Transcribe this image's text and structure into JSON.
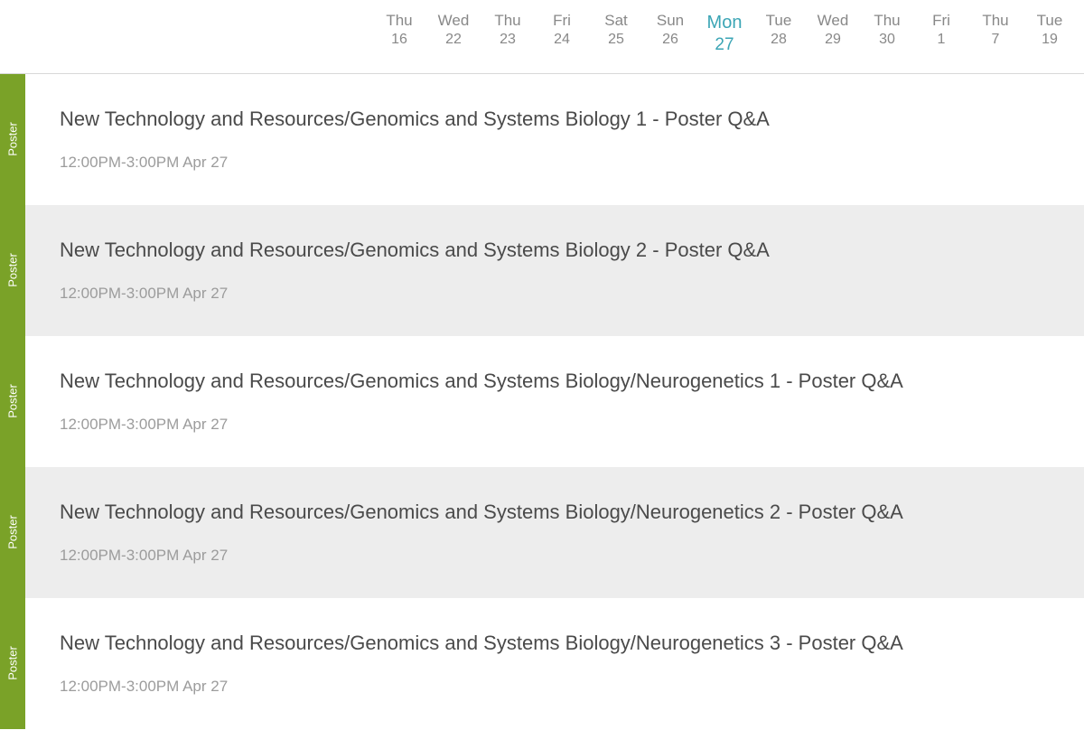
{
  "dateNav": {
    "items": [
      {
        "dow": "Thu",
        "dom": "16",
        "active": false
      },
      {
        "dow": "Wed",
        "dom": "22",
        "active": false
      },
      {
        "dow": "Thu",
        "dom": "23",
        "active": false
      },
      {
        "dow": "Fri",
        "dom": "24",
        "active": false
      },
      {
        "dow": "Sat",
        "dom": "25",
        "active": false
      },
      {
        "dow": "Sun",
        "dom": "26",
        "active": false
      },
      {
        "dow": "Mon",
        "dom": "27",
        "active": true
      },
      {
        "dow": "Tue",
        "dom": "28",
        "active": false
      },
      {
        "dow": "Wed",
        "dom": "29",
        "active": false
      },
      {
        "dow": "Thu",
        "dom": "30",
        "active": false
      },
      {
        "dow": "Fri",
        "dom": "1",
        "active": false
      },
      {
        "dow": "Thu",
        "dom": "7",
        "active": false
      },
      {
        "dow": "Tue",
        "dom": "19",
        "active": false
      }
    ]
  },
  "sideTag": {
    "label": "Poster"
  },
  "sessions": [
    {
      "title": "New Technology and Resources/Genomics and Systems Biology 1 - Poster Q&A",
      "time": "12:00PM-3:00PM Apr 27"
    },
    {
      "title": "New Technology and Resources/Genomics and Systems Biology 2 - Poster Q&A",
      "time": "12:00PM-3:00PM Apr 27"
    },
    {
      "title": "New Technology and Resources/Genomics and Systems Biology/Neurogenetics 1 - Poster Q&A",
      "time": "12:00PM-3:00PM Apr 27"
    },
    {
      "title": "New Technology and Resources/Genomics and Systems Biology/Neurogenetics 2 - Poster Q&A",
      "time": "12:00PM-3:00PM Apr 27"
    },
    {
      "title": "New Technology and Resources/Genomics and Systems Biology/Neurogenetics 3 - Poster Q&A",
      "time": "12:00PM-3:00PM Apr 27"
    }
  ]
}
